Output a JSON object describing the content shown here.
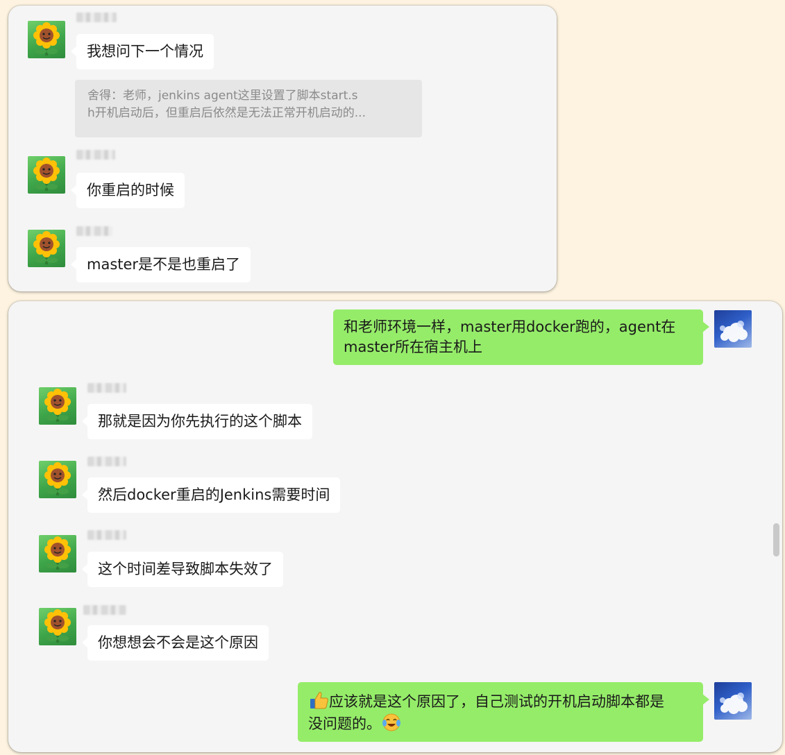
{
  "top_panel": {
    "messages": [
      {
        "text": "我想问下一个情况",
        "quote": {
          "line1": "舍得：老师，jenkins agent这里设置了脚本start.s",
          "line2": "h开机启动后，但重启后依然是无法正常开机启动的..."
        }
      },
      {
        "text": "你重启的时候"
      },
      {
        "text": "master是不是也重启了"
      }
    ]
  },
  "bottom_panel": {
    "self_message_1": "和老师环境一样，master用docker跑的，agent在master所在宿主机上",
    "messages": [
      {
        "text": "那就是因为你先执行的这个脚本"
      },
      {
        "text": "然后docker重启的Jenkins需要时间"
      },
      {
        "text": "这个时间差导致脚本失效了"
      },
      {
        "text": "你想想会不会是这个原因"
      }
    ],
    "self_message_2_line1": "应该就是这个原因了，自己测试的开机启动脚本都是",
    "self_message_2_line2": "没问题的。",
    "emoji_start": "thumbs-up-icon",
    "emoji_end": "laughing-tears-icon"
  },
  "colors": {
    "page_bg": "#fdf3e0",
    "panel_bg": "#f5f5f5",
    "incoming_bubble": "#ffffff",
    "outgoing_bubble": "#95ec69",
    "quote_bg": "#e6e6e6"
  }
}
